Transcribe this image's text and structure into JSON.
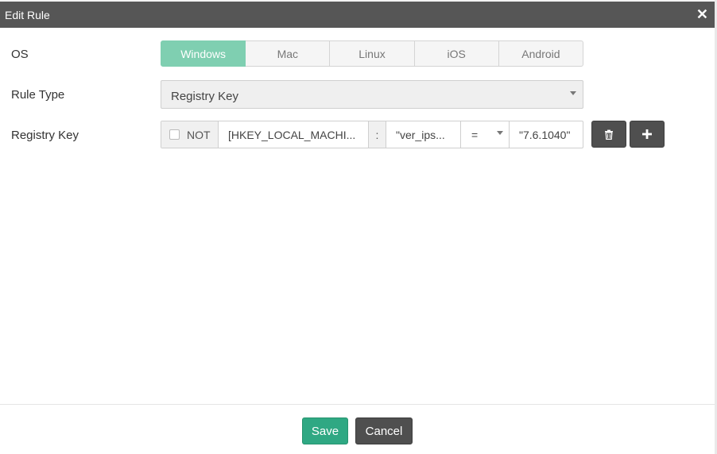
{
  "dialog": {
    "title": "Edit Rule",
    "close_glyph": "✕"
  },
  "os": {
    "label": "OS",
    "options": [
      "Windows",
      "Mac",
      "Linux",
      "iOS",
      "Android"
    ],
    "selected": "Windows"
  },
  "rule_type": {
    "label": "Rule Type",
    "value": "Registry Key"
  },
  "registry_key": {
    "label": "Registry Key",
    "not_label": "NOT",
    "not_checked": false,
    "key_path": "[HKEY_LOCAL_MACHI...",
    "separator": ":",
    "value_name": "\"ver_ips...",
    "operator": "=",
    "value_data": "\"7.6.1040\"",
    "delete_icon": "trash-icon",
    "add_icon": "plus-icon"
  },
  "footer": {
    "save_label": "Save",
    "cancel_label": "Cancel"
  },
  "colors": {
    "header_bg": "#565656",
    "os_active": "#7fcfb1",
    "save_bg": "#2fa883",
    "dark_button": "#4f4f4f"
  }
}
